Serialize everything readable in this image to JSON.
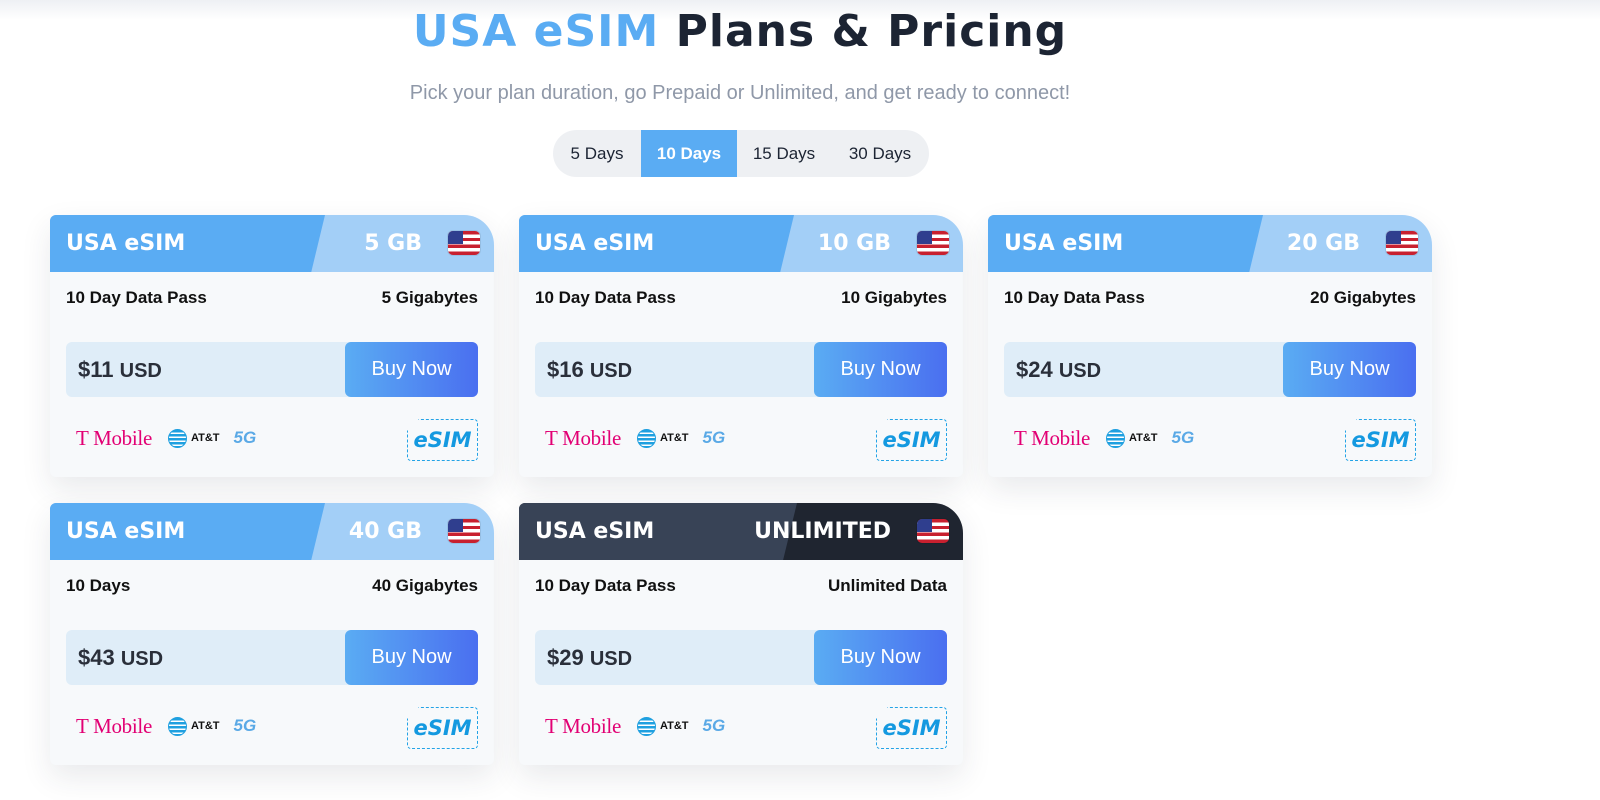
{
  "header": {
    "title_accent": "USA eSIM",
    "title_rest": "Plans & Pricing",
    "subtitle": "Pick your plan duration, go Prepaid or Unlimited, and get ready to connect!"
  },
  "duration_tabs": [
    {
      "label": "5 Days",
      "active": false
    },
    {
      "label": "10 Days",
      "active": true
    },
    {
      "label": "15 Days",
      "active": false
    },
    {
      "label": "30 Days",
      "active": false
    }
  ],
  "plans": [
    {
      "name": "USA eSIM",
      "size": "5 GB",
      "pass": "10 Day Data Pass",
      "amount": "5 Gigabytes",
      "price": "$11",
      "currency": "USD",
      "buy_label": "Buy Now",
      "theme": "blue"
    },
    {
      "name": "USA eSIM",
      "size": "10 GB",
      "pass": "10 Day Data Pass",
      "amount": "10 Gigabytes",
      "price": "$16",
      "currency": "USD",
      "buy_label": "Buy Now",
      "theme": "blue"
    },
    {
      "name": "USA eSIM",
      "size": "20 GB",
      "pass": "10 Day Data Pass",
      "amount": "20 Gigabytes",
      "price": "$24",
      "currency": "USD",
      "buy_label": "Buy Now",
      "theme": "blue"
    },
    {
      "name": "USA eSIM",
      "size": "40 GB",
      "pass": "10 Days",
      "amount": "40 Gigabytes",
      "price": "$43",
      "currency": "USD",
      "buy_label": "Buy Now",
      "theme": "blue"
    },
    {
      "name": "USA eSIM",
      "size": "UNLIMITED",
      "pass": "10 Day Data Pass",
      "amount": "Unlimited Data",
      "price": "$29",
      "currency": "USD",
      "buy_label": "Buy Now",
      "theme": "dark"
    }
  ],
  "carriers": {
    "tmobile": "T Mobile",
    "att": "AT&T",
    "network": "5G"
  },
  "badge": "eSIM",
  "icons": {
    "flag": "us-flag-icon",
    "att": "att-globe-icon",
    "badge": "esim-chip-icon"
  },
  "colors": {
    "accent": "#5aacf3",
    "accent_light": "#a3cff7",
    "dark_header": "#1f2530",
    "buy_gradient_end": "#4a6ff0",
    "tmobile": "#e20074"
  }
}
